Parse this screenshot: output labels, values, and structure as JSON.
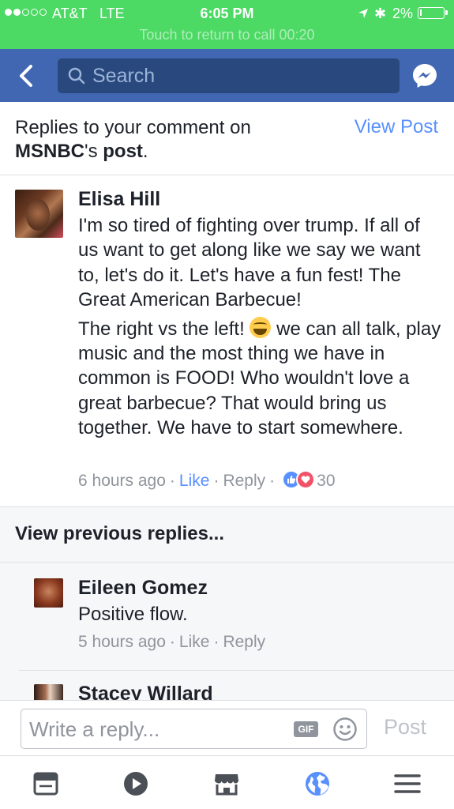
{
  "status_bar": {
    "carrier": "AT&T",
    "network": "LTE",
    "time": "6:05 PM",
    "battery": "2%",
    "call_banner": "Touch to return to call 00:20"
  },
  "nav": {
    "search_placeholder": "Search"
  },
  "header": {
    "text_prefix": "Replies to your comment on",
    "page_name": "MSNBC",
    "possessive": "'s ",
    "post_word": "post",
    "period": ".",
    "view_post": "View Post"
  },
  "main_comment": {
    "author": "Elisa Hill",
    "text_part1": "I'm so tired of fighting over trump. If all of us want to get along like we say we want to, let's do it. Let's have a fun fest! The Great American Barbecue!",
    "text_part2a": "The right vs the left!",
    "text_part2b": " we can all talk, play music and the most thing we have in common is FOOD! Who wouldn't love a great barbecue? That would bring us together. We have to start somewhere.",
    "time": "6 hours ago",
    "like": "Like",
    "reply": "Reply",
    "reaction_count": "30",
    "sep": "·"
  },
  "previous_replies": "View previous replies...",
  "replies": [
    {
      "author": "Eileen Gomez",
      "text": "Positive flow.",
      "time": "5 hours ago",
      "like": "Like",
      "reply": "Reply"
    },
    {
      "author": "Stacey Willard"
    }
  ],
  "composer": {
    "placeholder": "Write a reply...",
    "gif": "GIF",
    "post": "Post"
  },
  "tabs": [
    "news-feed-icon",
    "video-icon",
    "marketplace-icon",
    "notifications-globe-icon",
    "menu-icon"
  ],
  "colors": {
    "status_green": "#4cd964",
    "nav_blue": "#4267b2",
    "link_blue": "#5890ff",
    "muted_gray": "#90949c"
  }
}
